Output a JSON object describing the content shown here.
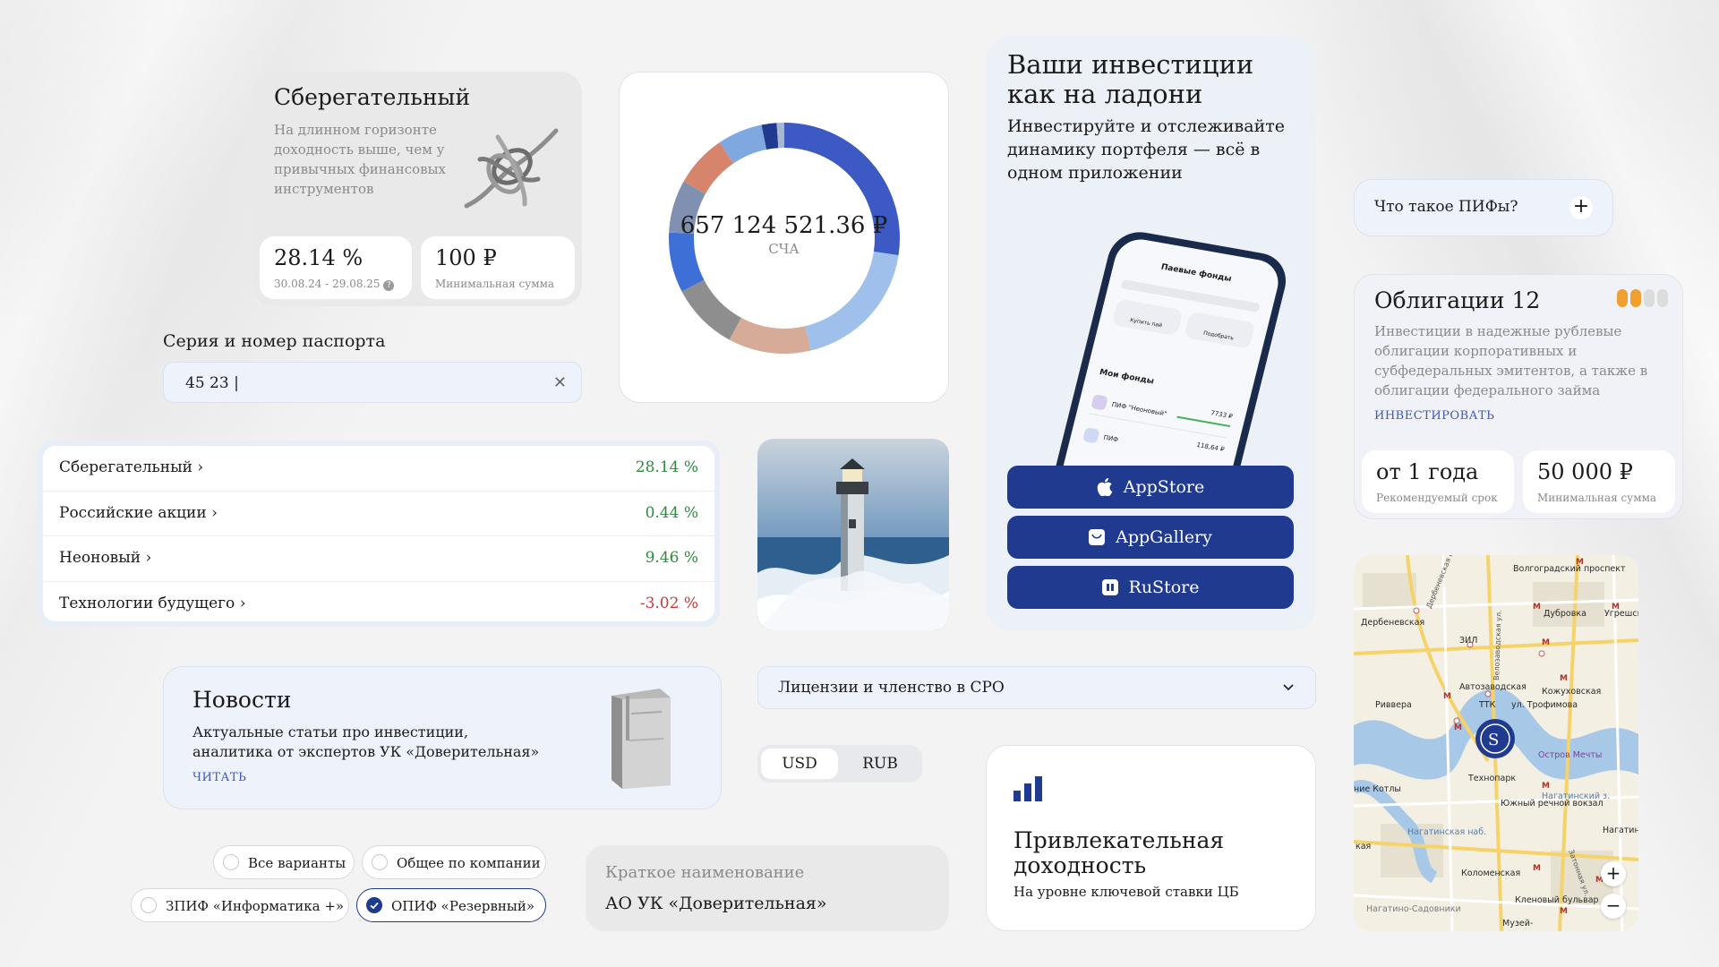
{
  "savings": {
    "title": "Сберегательный",
    "description": "На длинном горизонте доходность выше, чем у привычных финансовых инструментов",
    "yield_value": "28.14 %",
    "yield_period": "30.08.24 - 29.08.25",
    "min_value": "100 ₽",
    "min_label": "Минимальная сумма"
  },
  "passport": {
    "label": "Серия и номер паспорта",
    "value": "45 23 |"
  },
  "donut": {
    "amount": "657 124 521.36 ₽",
    "caption": "СЧА",
    "segments": [
      {
        "value": 26,
        "color": "#3d5ac4"
      },
      {
        "value": 18,
        "color": "#9fc0ea"
      },
      {
        "value": 11,
        "color": "#d6ab98"
      },
      {
        "value": 9,
        "color": "#8e8e8e"
      },
      {
        "value": 8,
        "color": "#3d6fd6"
      },
      {
        "value": 7,
        "color": "#7f90b0"
      },
      {
        "value": 7,
        "color": "#d6846c"
      },
      {
        "value": 6,
        "color": "#7fa8e0"
      },
      {
        "value": 2,
        "color": "#1f3a8f"
      },
      {
        "value": 1,
        "color": "#a9b6cf"
      }
    ]
  },
  "app": {
    "title": "Ваши инвестиции как на ладони",
    "description": "Инвестируйте и отслеживайте динамику портфеля — всё в одном приложении",
    "phone_header": "Паевые фонды",
    "phone_section": "Мои фонды",
    "phone_buy": "Купить пай",
    "phone_pick": "Подобрать",
    "phone_fund1": "ПИФ \"Неоновый\"",
    "phone_fund1_val": "7733 ₽",
    "phone_fund2": "ПИФ",
    "phone_fund2_val": "118,64 ₽",
    "appstore": "AppStore",
    "appgallery": "AppGallery",
    "rustore": "RuStore"
  },
  "faq": {
    "question": "Что такое ПИФы?"
  },
  "bonds": {
    "title": "Облигации 12",
    "description": "Инвестиции в надежные рублевые облигации корпоративных и субфедеральных эмитентов, а также в облигации федерального займа",
    "link": "ИНВЕСТИРОВАТЬ",
    "term_value": "от 1 года",
    "term_label": "Рекомендуемый срок",
    "min_value": "50 000 ₽",
    "min_label": "Минимальная сумма",
    "risk_level": 2,
    "risk_max": 4,
    "risk_color": "#f0a030"
  },
  "funds": [
    {
      "name": "Сберегательный",
      "pct": "28.14 %",
      "color": "#2e8a3e"
    },
    {
      "name": "Российские акции",
      "pct": "0.44 %",
      "color": "#2e8a3e"
    },
    {
      "name": "Неоновый",
      "pct": "9.46 %",
      "color": "#2e8a3e"
    },
    {
      "name": "Технологии будущего",
      "pct": "-3.02 %",
      "color": "#c23a3a"
    }
  ],
  "news": {
    "title": "Новости",
    "description_line1": "Актуальные статьи про инвестиции,",
    "description_line2": "аналитика от экспертов УК «Доверительная»",
    "link": "ЧИТАТЬ"
  },
  "licenses": {
    "label": "Лицензии и членство в СРО"
  },
  "currency": {
    "options": [
      "USD",
      "RUB"
    ],
    "selected": "USD"
  },
  "yield_card": {
    "title_line1": "Привлекательная",
    "title_line2": "доходность",
    "description": "На уровне ключевой ставки ЦБ"
  },
  "radios": [
    {
      "label": "Все варианты",
      "selected": false
    },
    {
      "label": "Общее по компании",
      "selected": false
    },
    {
      "label": "ЗПИФ «Информатика +»",
      "selected": false
    },
    {
      "label": "ОПИФ «Резервный»",
      "selected": true
    }
  ],
  "short_name": {
    "label": "Краткое наименование",
    "value": "АО УК «Доверительная»"
  },
  "map": {
    "labels": [
      "Волгоградский проспект",
      "Дербеневская",
      "Дубровка",
      "Угрешская",
      "ЗИЛ",
      "Автозаводская",
      "Кожуховская",
      "Риввера",
      "ТТК",
      "ул. Трофимова",
      "Технопарк",
      "Остров Мечты",
      "Южный речной вокзал",
      "Нагатинская наб.",
      "Коломенская",
      "Кленовый бульвар",
      "Нагатино-Садовники",
      "Нагатин",
      "Музей-",
      "кая",
      "ние Котлы",
      "Дербеневская наб.",
      "Велозаводская ул.",
      "Затонная ул.",
      "Нагатинский з."
    ]
  }
}
